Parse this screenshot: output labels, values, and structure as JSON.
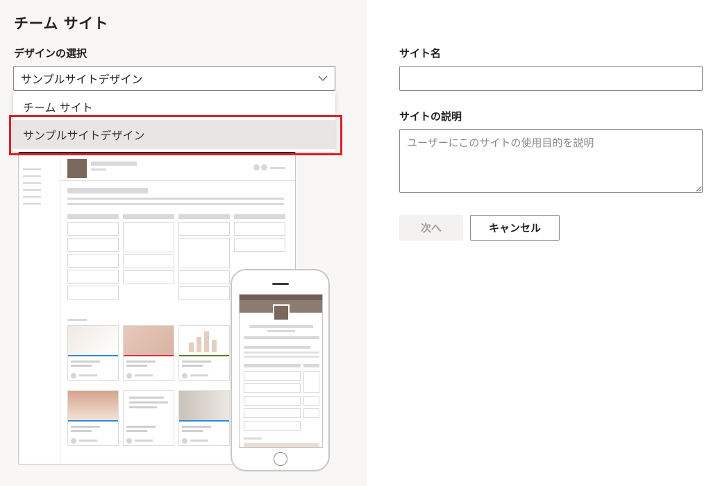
{
  "page": {
    "title": "チーム サイト"
  },
  "design": {
    "label": "デザインの選択",
    "selected": "サンプルサイトデザイン",
    "options": [
      "チーム サイト",
      "サンプルサイトデザイン"
    ]
  },
  "form": {
    "site_name_label": "サイト名",
    "site_name_value": "",
    "description_label": "サイトの説明",
    "description_placeholder": "ユーザーにこのサイトの使用目的を説明",
    "next_label": "次へ",
    "cancel_label": "キャンセル"
  },
  "colors": {
    "highlight": "#e01e2a",
    "card_accent_blue": "#2b88d8",
    "card_accent_red": "#d13438",
    "card_accent_green": "#498205",
    "brand_tile": "#7a685c"
  },
  "icons": {
    "select_chevron": "chevron-down-icon"
  }
}
